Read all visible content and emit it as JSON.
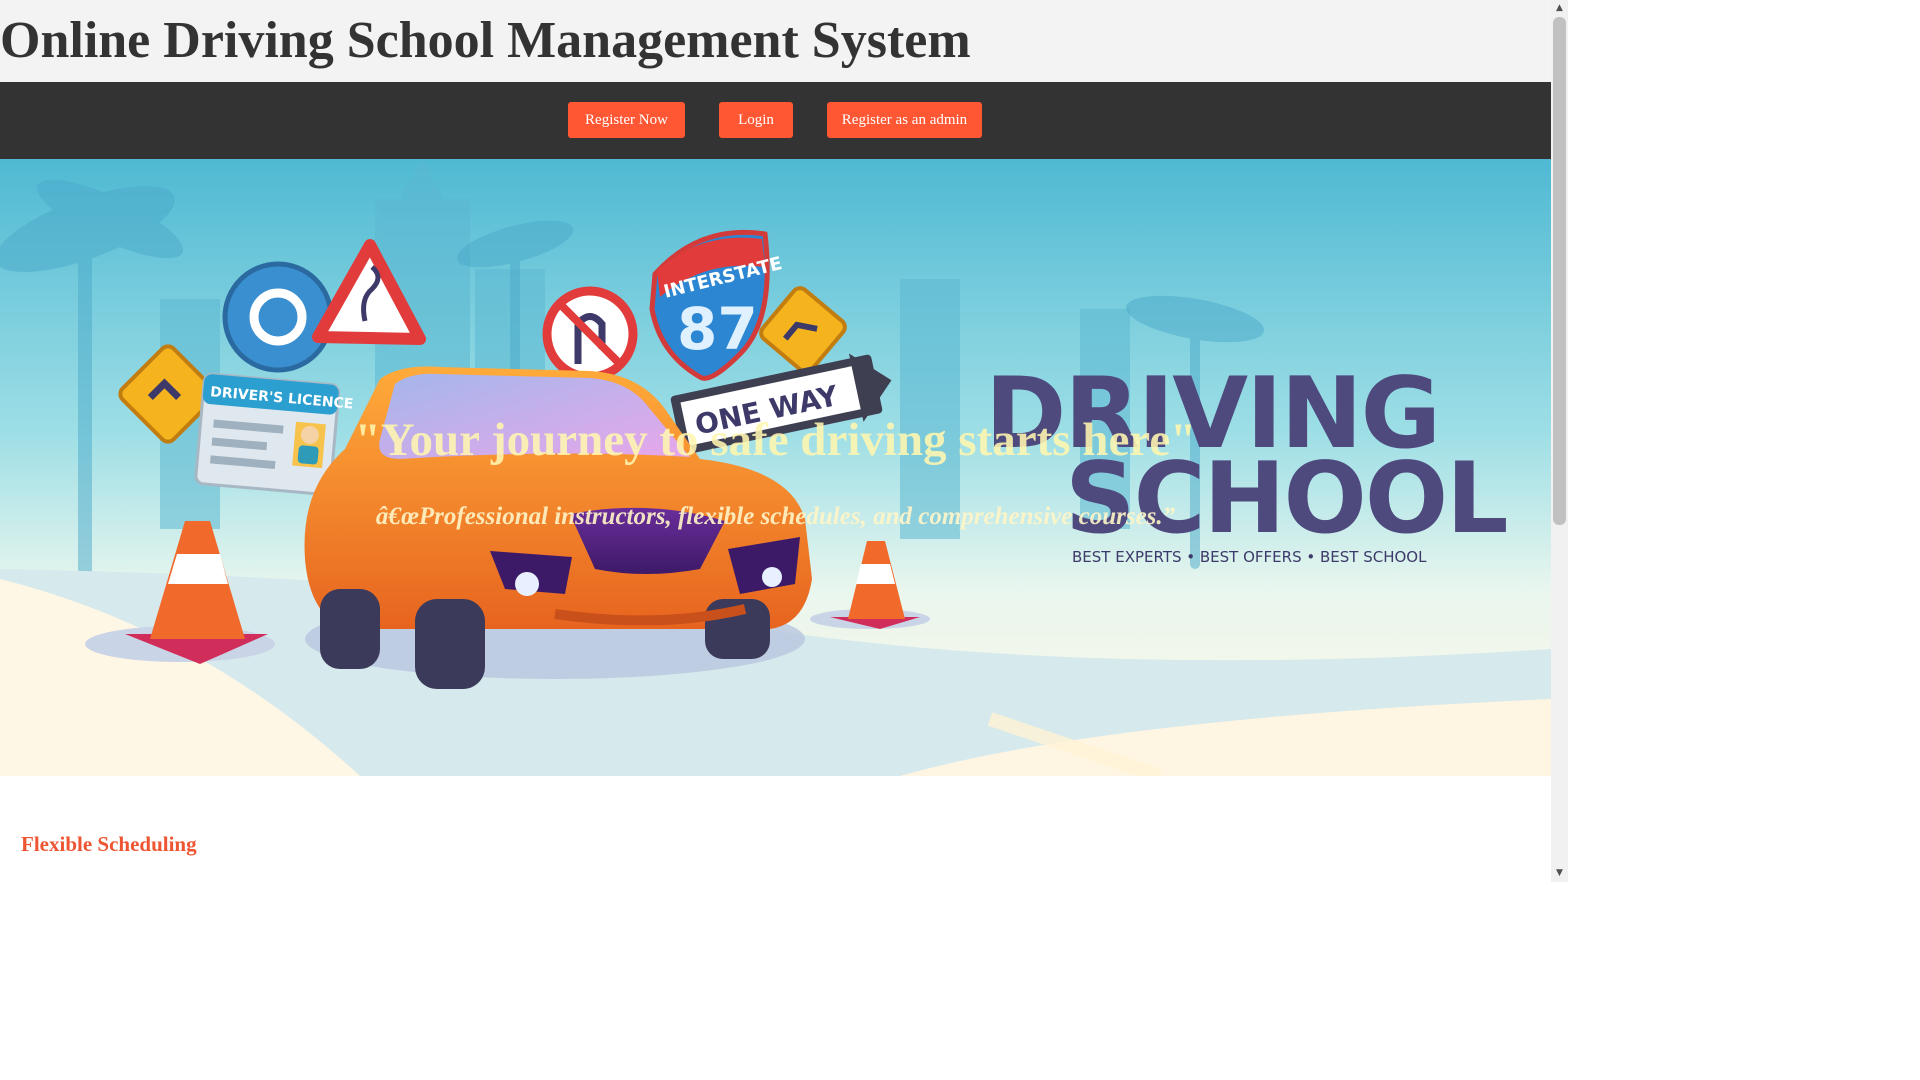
{
  "header": {
    "title": "Online Driving School Management System"
  },
  "nav": {
    "register_now": "Register Now",
    "login": "Login",
    "register_admin": "Register as an admin"
  },
  "hero": {
    "headline": "\"Your journey to safe driving starts here\"",
    "subheadline": "â€œProfessional instructors, flexible schedules, and comprehensive courses.”",
    "banner": {
      "line1": "DRIVING",
      "line2": "SCHOOL",
      "tagline": "BEST EXPERTS • BEST OFFERS • BEST SCHOOL",
      "licence_label": "DRIVER'S LICENCE",
      "interstate_label": "INTERSTATE",
      "interstate_number": "87",
      "oneway_label": "ONE WAY"
    }
  },
  "features": {
    "first_title": "Flexible Scheduling"
  },
  "colors": {
    "button": "#ff5733",
    "navbar": "#333333",
    "header_bg": "#f3f3f3",
    "brand_text": "#4e4a7e",
    "section_title": "#ee5533"
  },
  "icons": {
    "scroll_up": "triangle-up",
    "scroll_down": "triangle-down"
  }
}
